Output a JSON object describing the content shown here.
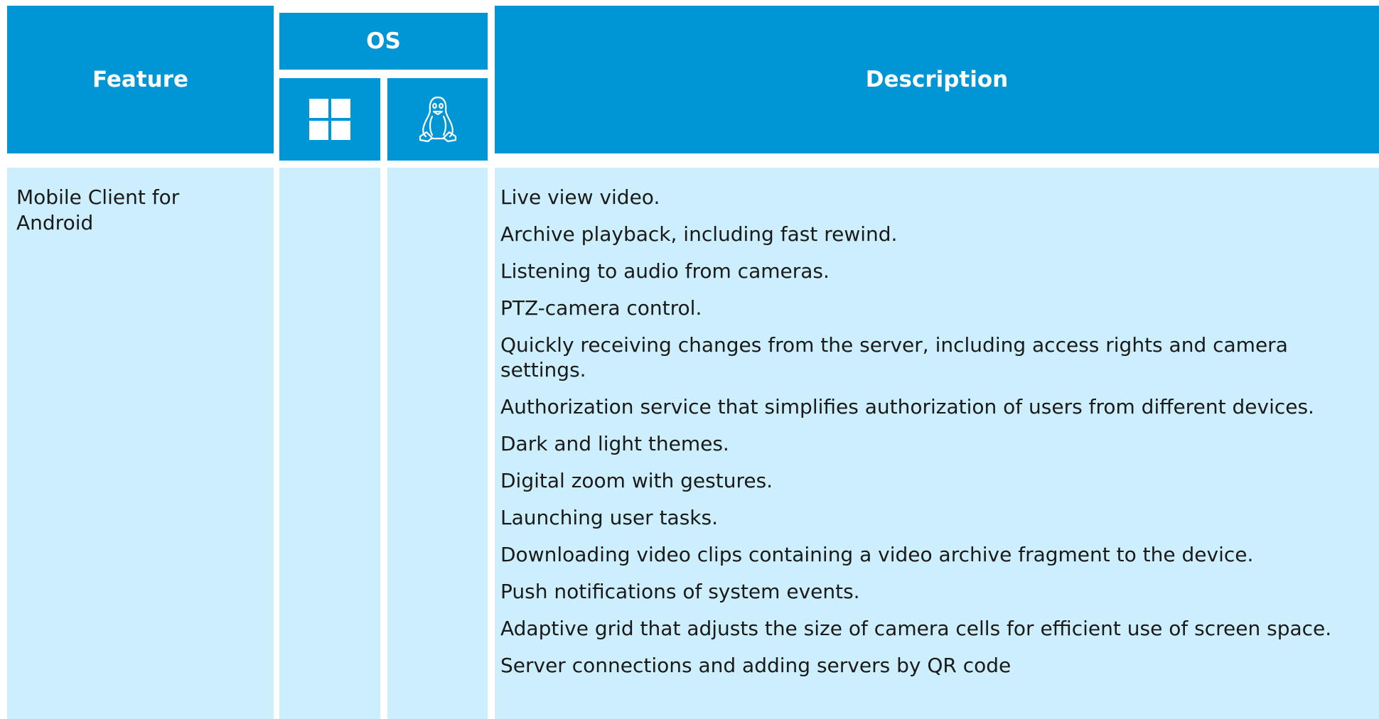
{
  "header": {
    "feature": "Feature",
    "os": "OS",
    "description": "Description",
    "os_icons": [
      "windows-icon",
      "linux-icon"
    ]
  },
  "colors": {
    "header_bg": "#0096d6",
    "row_bg": "#cdeefd",
    "text": "#1a1a1a"
  },
  "rows": [
    {
      "feature": "Mobile Client for Android",
      "descriptions": [
        "Live view video.",
        "Archive playback, including fast rewind.",
        "Listening to audio from cameras.",
        "PTZ-camera control.",
        "Quickly receiving changes from the server, including access rights and camera settings.",
        "Authorization service that simplifies authorization of users from different devices.",
        "Dark and light themes.",
        "Digital zoom with gestures.",
        "Launching user tasks.",
        "Downloading video clips containing a video archive fragment to the device.",
        "Push notifications of system events.",
        "Adaptive grid that adjusts the size of camera cells for efficient use of screen space.",
        "Server connections and adding servers by QR code"
      ]
    }
  ]
}
